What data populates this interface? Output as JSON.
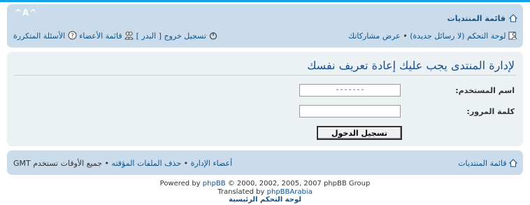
{
  "header": {
    "forum_index": "قائمة المنتديات",
    "font_controls": "^A^",
    "control_panel": "لوحة التحكم (لا رسائل جديدة)",
    "bullet": "•",
    "view_posts": "عرض مشاركاتك",
    "logout": "تسجيل خروج [ البدر ]",
    "members": "قائمة الأعضاء",
    "faq": "الأسئلة المتكررة"
  },
  "login": {
    "title": "لإدارة المنتدى يجب عليك إعادة تعريف نفسك",
    "username_label": "اسم المستخدم:",
    "username_value": "-------",
    "password_label": "كلمة المرور:",
    "password_value": "",
    "submit_label": "تسجيل الدخول"
  },
  "bottom_nav": {
    "forum_index": "قائمة المنتديات",
    "team": "أعضاء الإدارة",
    "bullet": "•",
    "delete_cookies": "حذف الملفات المؤقته",
    "timezone": "جميع الأوقات تستخدم GMT"
  },
  "footer": {
    "powered_prefix": "Powered by",
    "phpbb": "phpBB",
    "powered_suffix": "© 2000, 2002, 2005, 2007 phpBB Group",
    "translated_prefix": "Translated by",
    "phpbbarabia": "phpBBArabia",
    "acp_link": "لوحة التحكم الرئيسية"
  },
  "colors": {
    "navbar": "#cadceb",
    "panel": "#ecf1f3",
    "link": "#105289",
    "title": "#115098",
    "top_accent": "#12a3eb"
  },
  "icons": [
    "home-icon",
    "user-cp-icon",
    "power-icon",
    "members-icon",
    "faq-icon"
  ]
}
